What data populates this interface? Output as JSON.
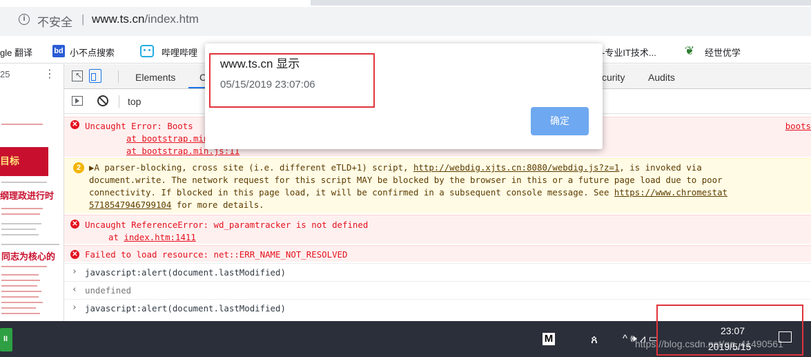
{
  "browser": {
    "insecure_label": "不安全",
    "separator": "|",
    "url_domain": "www.ts.cn",
    "url_path": "/index.htm"
  },
  "bookmarks": [
    {
      "label": "gle 翻译"
    },
    {
      "label": "小不点搜索",
      "badge": "bd"
    },
    {
      "label": "哔哩哔哩"
    },
    {
      "label": "-专业IT技术..."
    },
    {
      "label": "经世优学"
    }
  ],
  "page_strip": {
    "zoom": "25",
    "menu": "⋮",
    "banner_text": "目标",
    "heading1": "纲理政进行时",
    "heading2": "同志为核心的"
  },
  "devtools": {
    "tabs": [
      "Elements",
      "C",
      "curity",
      "Audits"
    ],
    "context": "top"
  },
  "console": {
    "error1": {
      "text": "Uncaught Error: Boots",
      "source": "boots",
      "stack": [
        "at bootstrap.min.",
        "at bootstrap.min.js:11"
      ]
    },
    "warning": {
      "count": "2",
      "lines": [
        "▶A parser-blocking, cross site (i.e. different eTLD+1) script, ",
        "http://webdig.xjts.cn:8080/webdig.js?z=1",
        ", is invoked via",
        "document.write. The network request for this script MAY be blocked by the browser in this or a future page load due to poor",
        "connectivity. If blocked in this page load, it will be confirmed in a subsequent console message. See ",
        "https://www.chromestat",
        "5718547946799104",
        " for more details."
      ]
    },
    "error2": {
      "text": "Uncaught ReferenceError: wd_paramtracker is not defined",
      "stack_prefix": "at ",
      "stack_link": "index.htm:1411"
    },
    "error3": {
      "text": "Failed to load resource: net::ERR_NAME_NOT_RESOLVED"
    },
    "input1": "javascript:alert(document.lastModified)",
    "output1": "undefined",
    "input2": "javascript:alert(document.lastModified)"
  },
  "dialog": {
    "origin": "www.ts.cn 显示",
    "message": "05/15/2019 23:07:06",
    "ok_label": "确定"
  },
  "taskbar": {
    "m_label": "M",
    "people_glyph": "ጰ",
    "tray": "^ 🕪 ⩘ ▭",
    "time": "23:07",
    "date": "2019/5/15",
    "watermark": "https://blog.csdn.net/qq_41490561"
  },
  "colors": {
    "highlight_box": "#e0343b",
    "ok_button": "#6ea8f0",
    "error_text": "#e3121e",
    "taskbar": "#2b2f3a"
  }
}
